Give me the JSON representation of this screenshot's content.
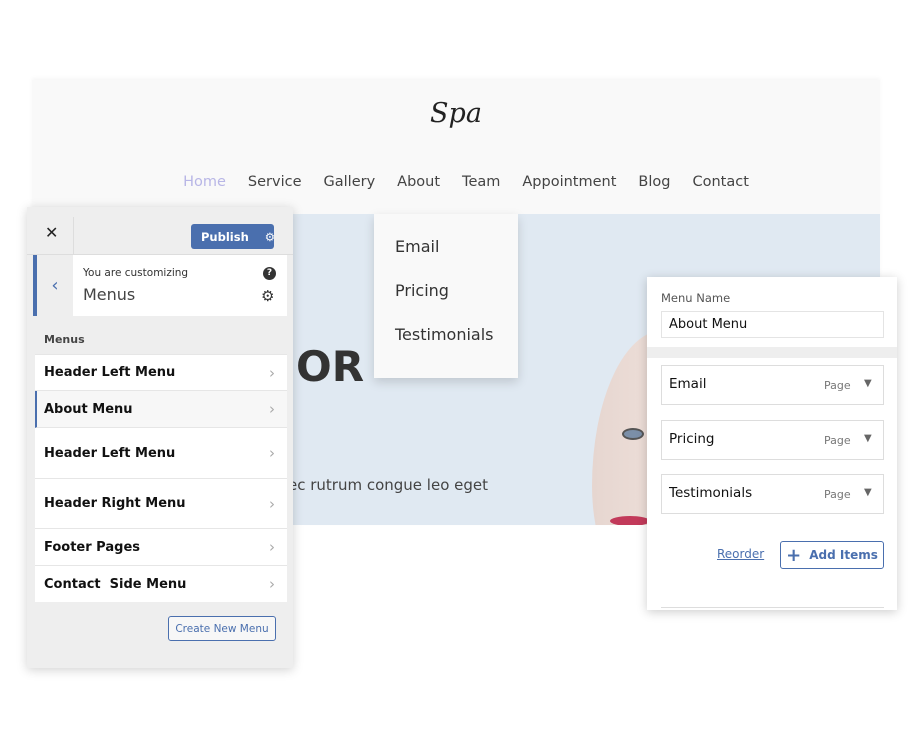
{
  "site": {
    "logo": "Spa",
    "nav": [
      "Home",
      "Service",
      "Gallery",
      "About",
      "Team",
      "Appointment",
      "Blog",
      "Contact"
    ],
    "active_nav": "Home",
    "hero_title": "OR",
    "hero_text": "ec rutrum congue leo eget",
    "dropdown": [
      "Email",
      "Pricing",
      "Testimonials"
    ]
  },
  "customizer": {
    "close": "✕",
    "publish": "Publish",
    "customizing_label": "You are customizing",
    "customizing_title": "Menus",
    "section_label": "Menus",
    "menus": [
      "Header Left Menu",
      "About Menu",
      "Header Left Menu",
      "Header Right Menu",
      "Footer Pages",
      "Contact  Side Menu"
    ],
    "selected": "About Menu",
    "create_button": "Create New Menu"
  },
  "editor": {
    "menu_name_label": "Menu Name",
    "menu_name_value": "About Menu",
    "items": [
      {
        "title": "Email",
        "type": "Page"
      },
      {
        "title": "Pricing",
        "type": "Page"
      },
      {
        "title": "Testimonials",
        "type": "Page"
      }
    ],
    "reorder": "Reorder",
    "add_items": "Add Items"
  },
  "colors": {
    "accent": "#4a6fae",
    "hero_bg": "#e0e9f2",
    "active_nav": "#b8b6e6"
  }
}
